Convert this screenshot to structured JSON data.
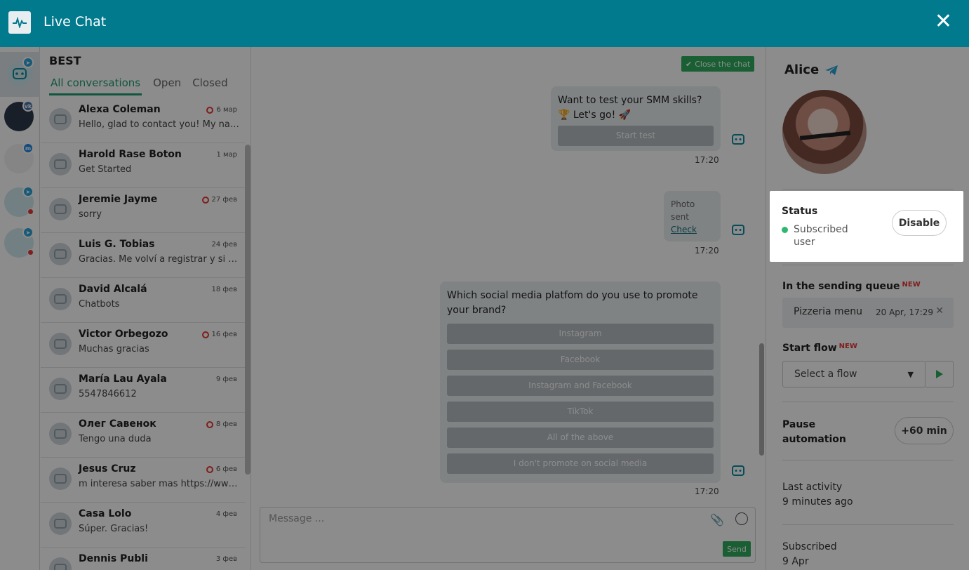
{
  "app": {
    "title": "Live Chat",
    "close_symbol": "✕"
  },
  "list": {
    "title": "BEST",
    "tabs": [
      {
        "label": "All conversations"
      },
      {
        "label": "Open"
      },
      {
        "label": "Closed"
      }
    ],
    "items": [
      {
        "name": "Alexa Coleman",
        "preview": "Hello, glad to contact you! My name is...",
        "date": "6 мар",
        "unread": true
      },
      {
        "name": "Harold Rase Boton",
        "preview": "Get Started",
        "date": "1 мар",
        "unread": false
      },
      {
        "name": "Jeremie Jayme",
        "preview": "sorry",
        "date": "27 фев",
        "unread": true
      },
      {
        "name": "Luis G. Tobias",
        "preview": "Gracias. Me volví a registrar y si puedo",
        "date": "24 фев",
        "unread": false
      },
      {
        "name": "David Alcalá",
        "preview": "Chatbots",
        "date": "18 фев",
        "unread": false
      },
      {
        "name": "Victor Orbegozo",
        "preview": "Muchas gracias",
        "date": "16 фев",
        "unread": true
      },
      {
        "name": "María Lau Ayala",
        "preview": "5547846612",
        "date": "9 фев",
        "unread": false
      },
      {
        "name": "Олег Савенок",
        "preview": "Tengo una duda",
        "date": "8 фев",
        "unread": true
      },
      {
        "name": "Jesus Cruz",
        "preview": "m interesa saber mas https://www.facebook",
        "date": "6 фев",
        "unread": true
      },
      {
        "name": "Casa Lolo",
        "preview": "Súper. Gracias!",
        "date": "4 фев",
        "unread": false
      },
      {
        "name": "Dennis Publi",
        "preview": "",
        "date": "3 фев",
        "unread": false
      }
    ]
  },
  "chat": {
    "close_chat_label": "Close the chat",
    "msg1": {
      "text": "Want to test your SMM skills? 🏆 Let's go! 🚀",
      "button": "Start test",
      "time": "17:20"
    },
    "msg2": {
      "text": "Photo sent",
      "link": "Check",
      "time": "17:20"
    },
    "msg3": {
      "text": "Which social media platfom do you use to promote your brand?",
      "buttons": [
        "Instagram",
        "Facebook",
        "Instagram and Facebook",
        "TikTok",
        "All of the above",
        "I don't promote on social media"
      ],
      "time": "17:20"
    },
    "composer": {
      "placeholder": "Message ...",
      "send_label": "Send"
    }
  },
  "contact": {
    "name": "Alice",
    "status_label": "Status",
    "status_value": "Subscribed user",
    "disable_label": "Disable",
    "queue_label": "In the sending queue",
    "new_badge": "NEW",
    "queue_item": {
      "name": "Pizzeria menu",
      "time": "20 Apr, 17:29",
      "remove": "✕"
    },
    "start_flow_label": "Start flow",
    "flow_select": "Select a flow",
    "pause_label": "Pause automation",
    "pause_button": "+60 min",
    "last_activity_label": "Last activity",
    "last_activity_value": "9 minutes ago",
    "subscribed_label": "Subscribed",
    "subscribed_value": "9 Apr"
  },
  "colors": {
    "header": "#017a8e",
    "accent_green": "#2eae5e",
    "tab_active": "#1f9d74",
    "unread": "#e53935",
    "telegram": "#2aa3d8"
  }
}
